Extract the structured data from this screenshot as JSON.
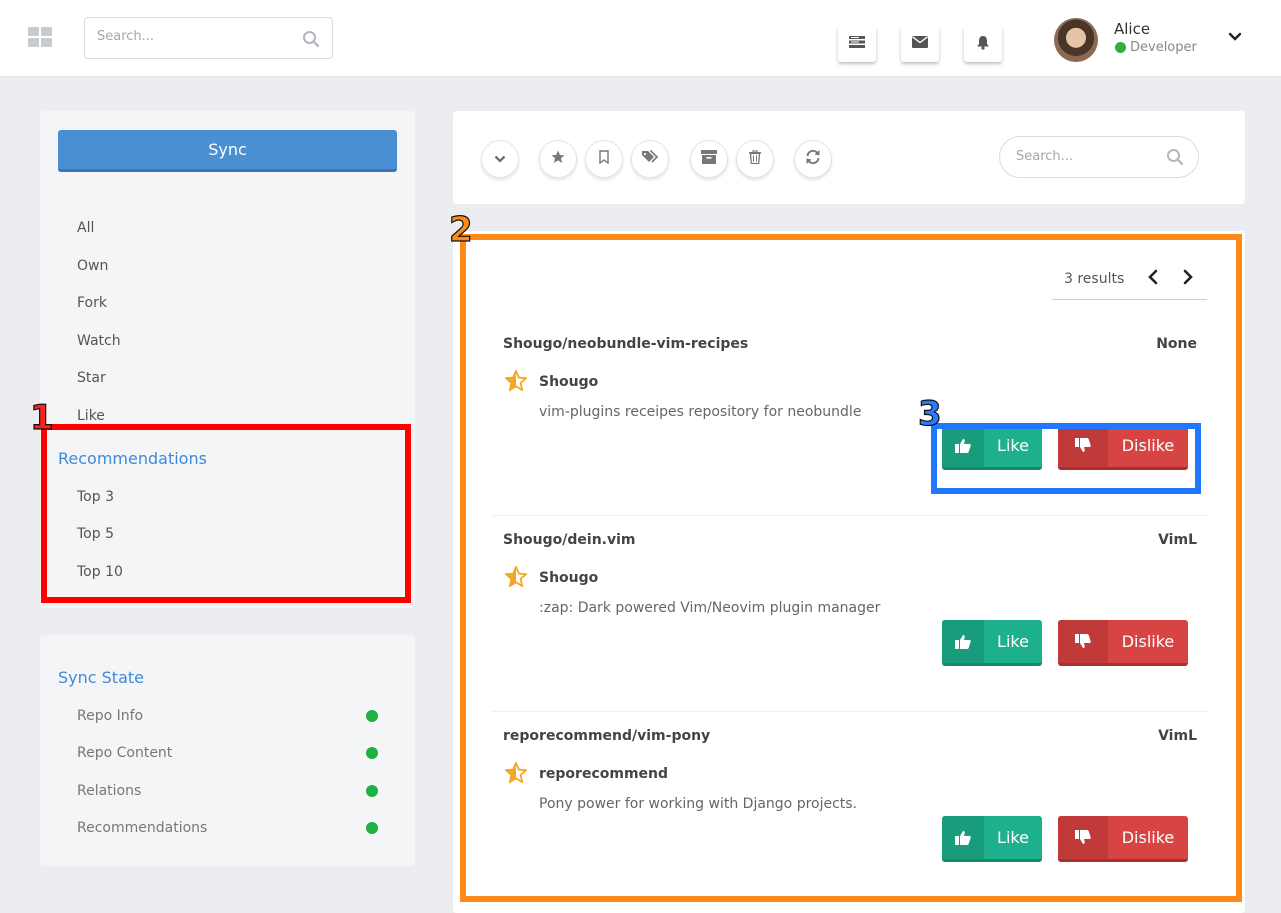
{
  "header": {
    "search_placeholder": "Search...",
    "user": {
      "name": "Alice",
      "role": "Developer"
    }
  },
  "sidebar": {
    "sync_label": "Sync",
    "items": [
      "All",
      "Own",
      "Fork",
      "Watch",
      "Star",
      "Like"
    ],
    "recommendations_title": "Recommendations",
    "recommendation_items": [
      "Top 3",
      "Top 5",
      "Top 10"
    ]
  },
  "sync_state": {
    "title": "Sync State",
    "items": [
      "Repo Info",
      "Repo Content",
      "Relations",
      "Recommendations"
    ],
    "status_color": "#1fb141"
  },
  "toolbar": {
    "search_placeholder": "Search..."
  },
  "results": {
    "count_label": "3 results",
    "repos": [
      {
        "name": "Shougo/neobundle-vim-recipes",
        "language": "None",
        "owner": "Shougo",
        "description": "vim-plugins receipes repository for neobundle",
        "like_label": "Like",
        "dislike_label": "Dislike"
      },
      {
        "name": "Shougo/dein.vim",
        "language": "VimL",
        "owner": "Shougo",
        "description": ":zap: Dark powered Vim/Neovim plugin manager",
        "like_label": "Like",
        "dislike_label": "Dislike"
      },
      {
        "name": "reporecommend/vim-pony",
        "language": "VimL",
        "owner": "reporecommend",
        "description": "Pony power for working with Django projects.",
        "like_label": "Like",
        "dislike_label": "Dislike"
      }
    ]
  },
  "annotations": [
    {
      "number": "1",
      "color": "#ff0000"
    },
    {
      "number": "2",
      "color": "#ff8a1a"
    },
    {
      "number": "3",
      "color": "#1f78ff"
    }
  ]
}
